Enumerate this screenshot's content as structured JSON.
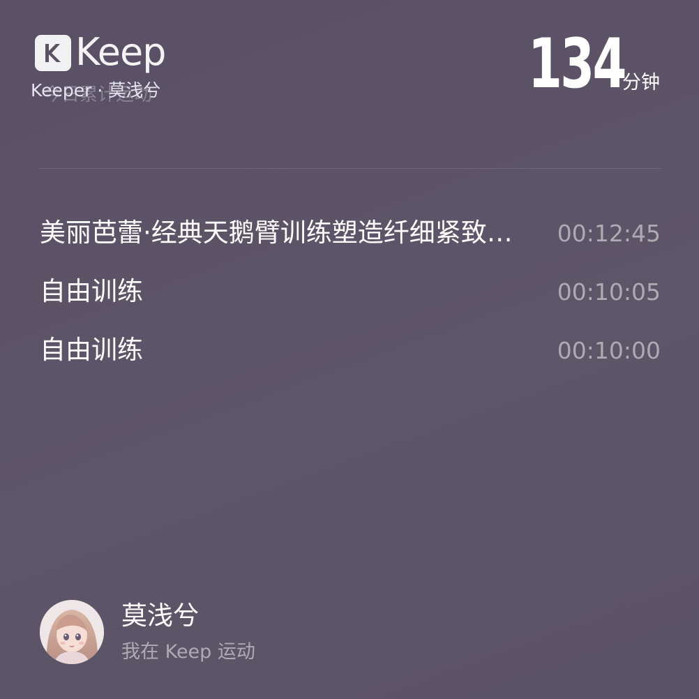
{
  "header": {
    "logo_text": "Keep",
    "caption": "Keeper · 莫浅兮",
    "caption_ghost": "今日累计运动",
    "total_value": "134",
    "total_unit": "分钟"
  },
  "workouts": [
    {
      "name": "美丽芭蕾·经典天鹅臂训练塑造纤细紧致手臂",
      "duration": "00:12:45"
    },
    {
      "name": "自由训练",
      "duration": "00:10:05"
    },
    {
      "name": "自由训练",
      "duration": "00:10:00"
    }
  ],
  "user": {
    "name": "莫浅兮",
    "subtitle": "我在 Keep 运动",
    "avatar_icon": "user-avatar-icon"
  },
  "colors": {
    "background": "#5b5266",
    "text_primary": "#ffffff",
    "text_secondary": "#aaa5b3"
  }
}
